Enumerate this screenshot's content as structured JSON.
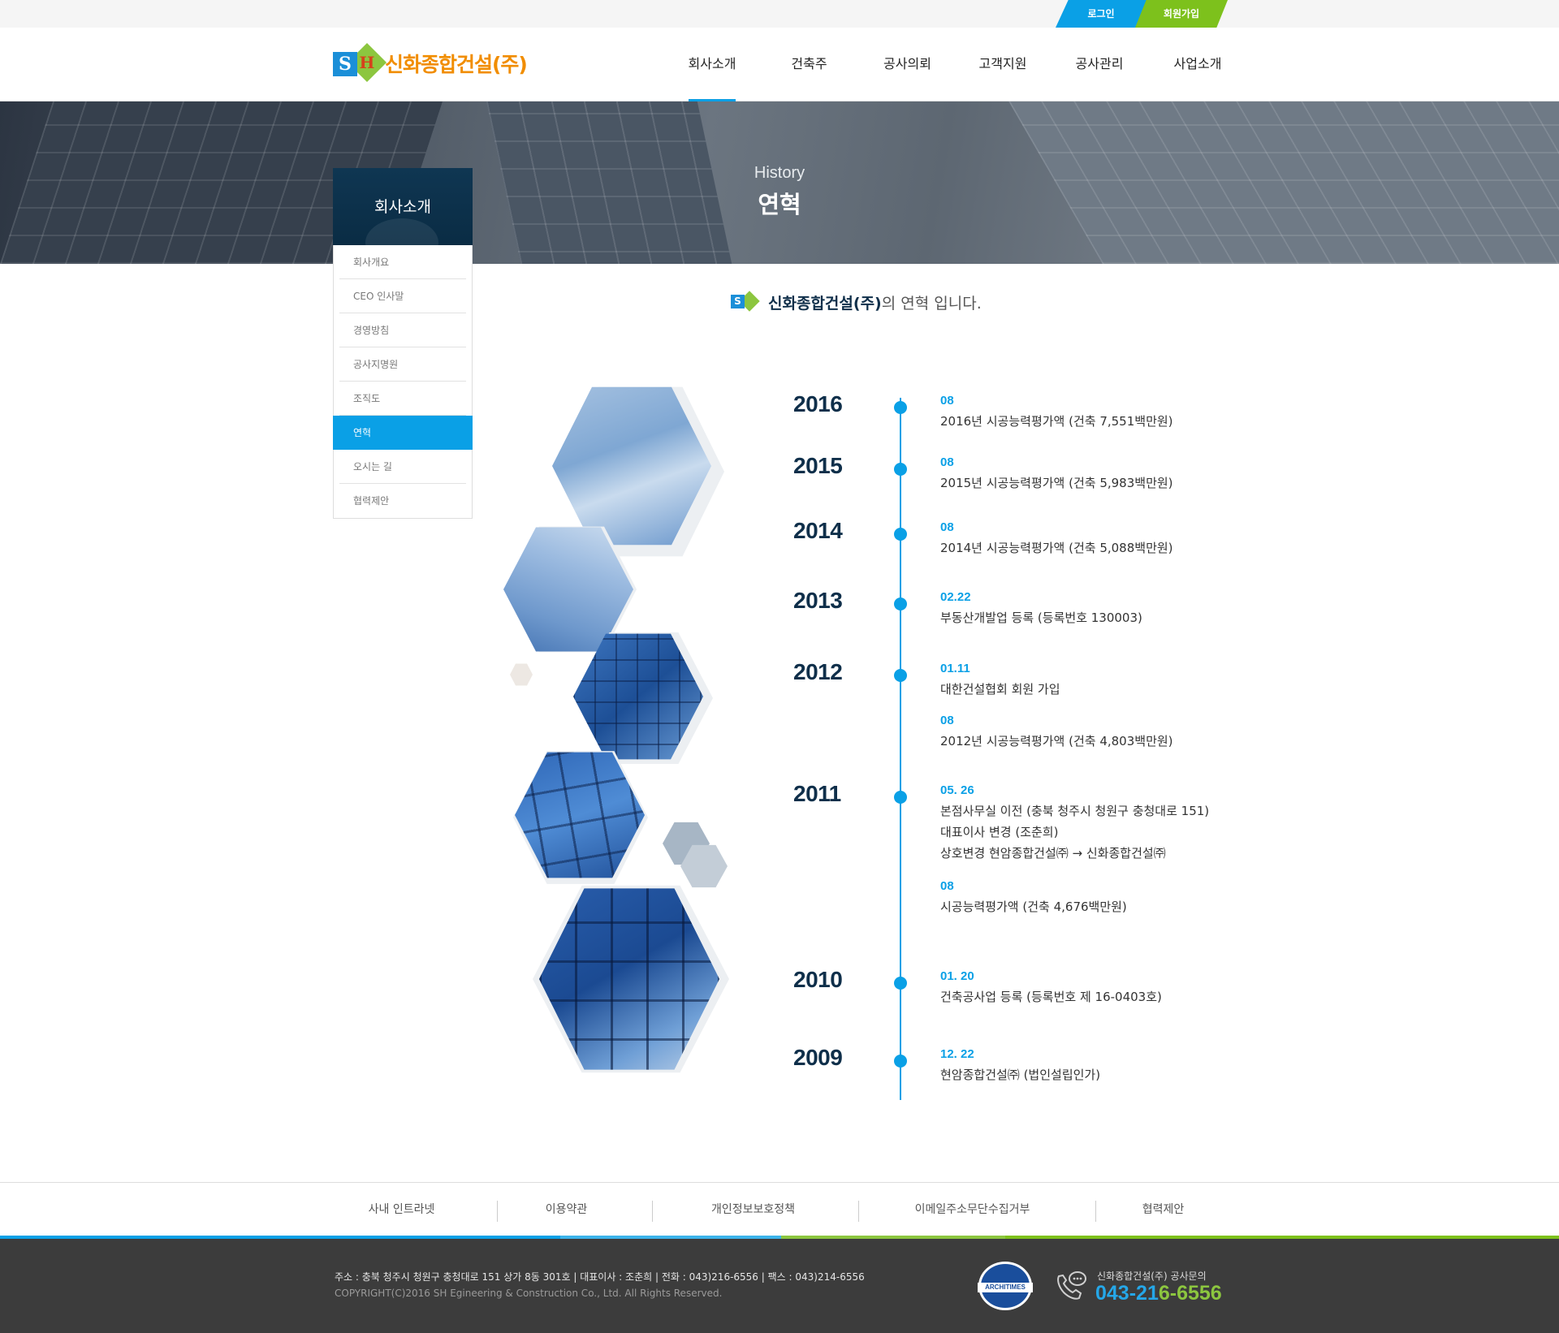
{
  "util": {
    "login": "로그인",
    "join": "회원가입"
  },
  "logo": {
    "s": "S",
    "h": "H",
    "text": "신화종합건설(주)"
  },
  "gnb": [
    "회사소개",
    "건축주",
    "공사의뢰",
    "고객지원",
    "공사관리",
    "사업소개"
  ],
  "banner": {
    "subtitle": "History",
    "title": "연혁"
  },
  "lnb": {
    "title": "회사소개",
    "items": [
      "회사개요",
      "CEO 인사말",
      "경영방침",
      "공사지명원",
      "조직도",
      "연혁",
      "오시는 길",
      "협력제안"
    ],
    "active_index": 5
  },
  "intro": {
    "company": "신화종합건설(주)",
    "rest": "의 연혁 입니다."
  },
  "timeline": [
    {
      "year": "2016",
      "entries": [
        {
          "date": "08",
          "lines": [
            "2016년 시공능력평가액 (건축 7,551백만원)"
          ]
        }
      ]
    },
    {
      "year": "2015",
      "entries": [
        {
          "date": "08",
          "lines": [
            "2015년 시공능력평가액 (건축 5,983백만원)"
          ]
        }
      ]
    },
    {
      "year": "2014",
      "entries": [
        {
          "date": "08",
          "lines": [
            "2014년 시공능력평가액 (건축 5,088백만원)"
          ]
        }
      ]
    },
    {
      "year": "2013",
      "entries": [
        {
          "date": "02.22",
          "lines": [
            "부동산개발업 등록 (등록번호 130003)"
          ]
        }
      ]
    },
    {
      "year": "2012",
      "entries": [
        {
          "date": "01.11",
          "lines": [
            "대한건설협회 회원 가입"
          ]
        },
        {
          "date": "08",
          "lines": [
            "2012년 시공능력평가액 (건축 4,803백만원)"
          ]
        }
      ]
    },
    {
      "year": "2011",
      "entries": [
        {
          "date": "05. 26",
          "lines": [
            "본점사무실 이전 (충북 청주시 청원구 충청대로 151)",
            "대표이사 변경 (조춘희)",
            "상호변경 현암종합건설㈜ → 신화종합건설㈜"
          ]
        },
        {
          "date": "08",
          "lines": [
            "시공능력평가액 (건축 4,676백만원)"
          ]
        }
      ]
    },
    {
      "year": "2010",
      "entries": [
        {
          "date": "01. 20",
          "lines": [
            "건축공사업 등록 (등록번호 제 16-0403호)"
          ]
        }
      ]
    },
    {
      "year": "2009",
      "entries": [
        {
          "date": "12. 22",
          "lines": [
            "현암종합건설㈜ (법인설립인가)"
          ]
        }
      ]
    }
  ],
  "footer_links": [
    "사내 인트라넷",
    "이용약관",
    "개인정보보호정책",
    "이메일주소무단수집거부",
    "협력제안"
  ],
  "footer": {
    "address": "주소 : 충북 청주시 청원구 충청대로 151 상가 8동 301호  |  대표이사 : 조춘희  |  전화 : 043)216-6556  |  팩스 : 043)214-6556",
    "copyright": "COPYRIGHT(C)2016  SH Egineering & Construction  Co., Ltd. All Rights Reserved.",
    "badge": "ARCHITIMES",
    "phone_label": "신화종합건설(주) 공사문의",
    "phone_part1": "043-21",
    "phone_part2": "6-6556"
  },
  "colors": {
    "accent_blue": "#0aa0e6",
    "accent_green": "#7dc11c",
    "logo_orange": "#f18d00",
    "navy": "#0f2f4a"
  },
  "icons": [
    "phone-icon",
    "architimes-badge"
  ]
}
